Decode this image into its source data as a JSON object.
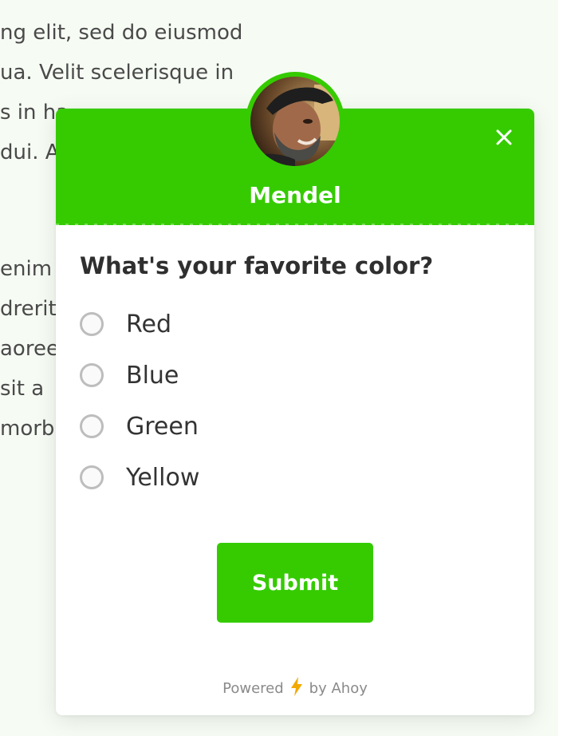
{
  "background": {
    "lines": [
      "ng elit, sed do eiusmod",
      "ua. Velit scelerisque in",
      "s in ha",
      "dui. A",
      "enim c",
      "drerit",
      "aoree",
      "sit a",
      "morb"
    ]
  },
  "popup": {
    "agent_name": "Mendel",
    "close_icon": "close-icon",
    "question": "What's your favorite color?",
    "options": [
      {
        "label": "Red"
      },
      {
        "label": "Blue"
      },
      {
        "label": "Green"
      },
      {
        "label": "Yellow"
      }
    ],
    "submit_label": "Submit",
    "footer": {
      "powered_label": "Powered",
      "by_label": "by Ahoy",
      "icon": "lightning-icon"
    }
  },
  "colors": {
    "brand_green": "#35cb00",
    "bolt_orange": "#f2a900"
  }
}
